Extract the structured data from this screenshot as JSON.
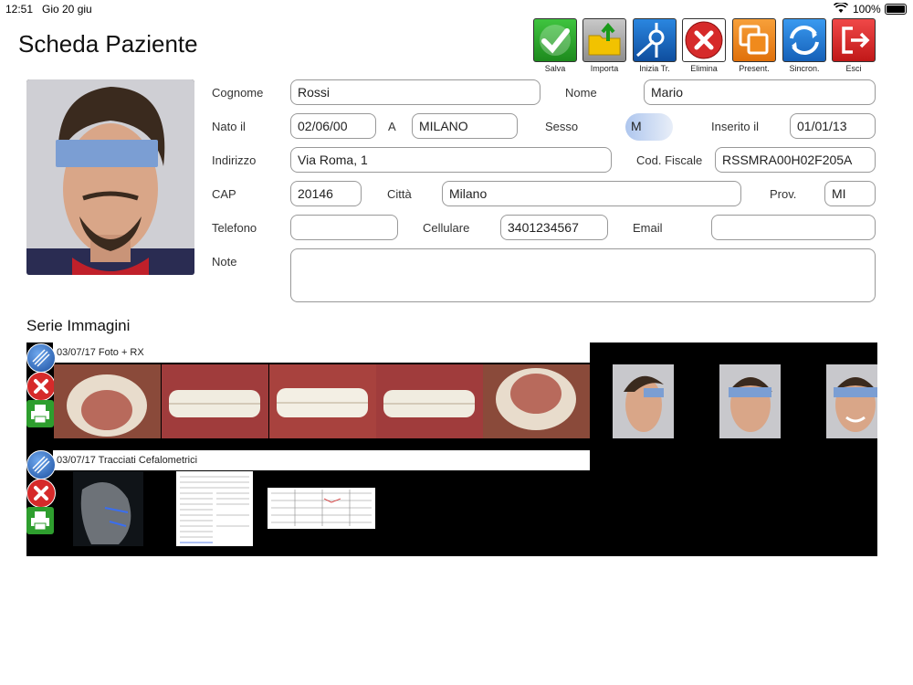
{
  "status_bar": {
    "time": "12:51",
    "date": "Gio 20 giu",
    "battery": "100%"
  },
  "page_title": "Scheda Paziente",
  "toolbar": [
    {
      "label": "Salva",
      "icon": "check-icon",
      "color": "#2e9e2e"
    },
    {
      "label": "Importa",
      "icon": "folder-import-icon",
      "color": "#9a9a9a"
    },
    {
      "label": "Inizia Tr.",
      "icon": "start-treatment-icon",
      "color": "#1e6fc8"
    },
    {
      "label": "Elimina",
      "icon": "delete-icon",
      "color": "#d62a2a"
    },
    {
      "label": "Present.",
      "icon": "presentation-icon",
      "color": "#f08a1c"
    },
    {
      "label": "Sincron.",
      "icon": "sync-icon",
      "color": "#1e7fd8"
    },
    {
      "label": "Esci",
      "icon": "exit-icon",
      "color": "#e23232"
    }
  ],
  "form": {
    "cognome_label": "Cognome",
    "cognome": "Rossi",
    "nome_label": "Nome",
    "nome": "Mario",
    "nato_label": "Nato il",
    "nato": "02/06/00",
    "a_label": "A",
    "luogo": "MILANO",
    "sesso_label": "Sesso",
    "sesso": "M",
    "inserito_label": "Inserito il",
    "inserito": "01/01/13",
    "indirizzo_label": "Indirizzo",
    "indirizzo": "Via Roma, 1",
    "cf_label": "Cod. Fiscale",
    "cf": "RSSMRA00H02F205A",
    "cap_label": "CAP",
    "cap": "20146",
    "citta_label": "Città",
    "citta": "Milano",
    "prov_label": "Prov.",
    "prov": "MI",
    "telefono_label": "Telefono",
    "telefono": "",
    "cellulare_label": "Cellulare",
    "cellulare": "3401234567",
    "email_label": "Email",
    "email": "",
    "note_label": "Note",
    "note": ""
  },
  "series_title": "Serie Immagini",
  "series": [
    {
      "title": "03/07/17 Foto + RX"
    },
    {
      "title": "03/07/17 Tracciati Cefalometrici"
    }
  ]
}
